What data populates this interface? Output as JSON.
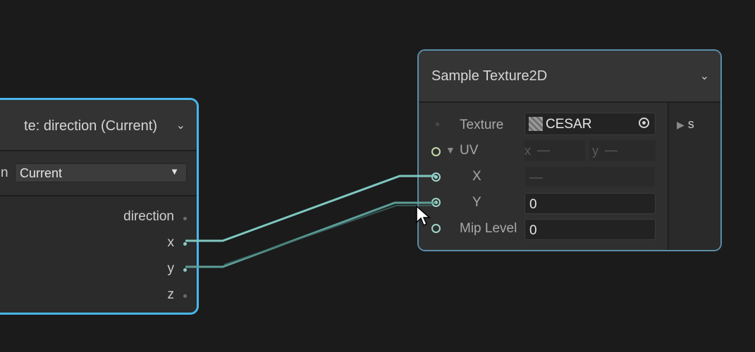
{
  "left_node": {
    "title": "te: direction (Current)",
    "option_label": "n",
    "dropdown_value": "Current",
    "outputs": [
      "direction",
      "x",
      "y",
      "z"
    ]
  },
  "right_node": {
    "title": "Sample Texture2D",
    "texture_label": "Texture",
    "texture_value": "CESAR",
    "uv_label": "UV",
    "uv_x_label": "x",
    "uv_x_value": "—",
    "uv_y_label": "y",
    "uv_y_value": "—",
    "x_label": "X",
    "x_value": "—",
    "y_label": "Y",
    "y_value": "0",
    "mip_label": "Mip Level",
    "mip_value": "0",
    "output_label": "s"
  },
  "icons": {
    "collapse": "chevron-down-icon",
    "dropdown": "triangle-down-icon",
    "expand": "triangle-down-icon",
    "texture": "texture-thumbnail-icon",
    "object_picker": "target-icon",
    "output": "triangle-right-icon",
    "cursor": "mouse-pointer-icon"
  },
  "colors": {
    "node_selected_border": "#4ab6ea",
    "wire": "#7fc8c1",
    "port": "#9ed6c8"
  }
}
